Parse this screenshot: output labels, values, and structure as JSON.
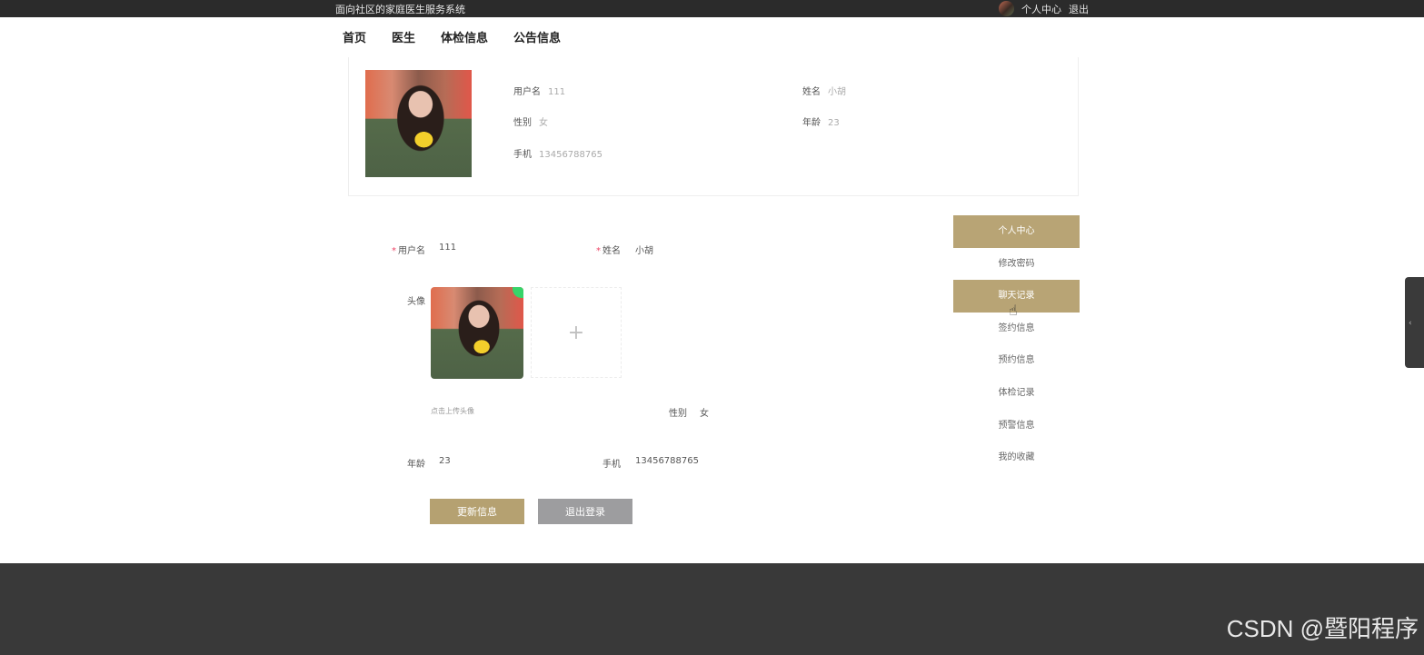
{
  "header": {
    "site_title": "面向社区的家庭医生服务系统",
    "personal_center": "个人中心",
    "logout": "退出"
  },
  "nav": {
    "items": [
      {
        "label": "首页"
      },
      {
        "label": "医生"
      },
      {
        "label": "体检信息"
      },
      {
        "label": "公告信息"
      }
    ]
  },
  "profile": {
    "username_label": "用户名",
    "username": "111",
    "name_label": "姓名",
    "name": "小胡",
    "gender_label": "性别",
    "gender": "女",
    "age_label": "年龄",
    "age": "23",
    "phone_label": "手机",
    "phone": "13456788765"
  },
  "form": {
    "username_label": "用户名",
    "username_value": "111",
    "name_label": "姓名",
    "name_value": "小胡",
    "avatar_label": "头像",
    "upload_plus": "+",
    "upload_hint": "点击上传头像",
    "gender_label": "性别",
    "gender_value": "女",
    "age_label": "年龄",
    "age_value": "23",
    "phone_label": "手机",
    "phone_value": "13456788765",
    "update_button": "更新信息",
    "logout_button": "退出登录"
  },
  "side_menu": {
    "items": [
      {
        "label": "个人中心"
      },
      {
        "label": "修改密码"
      },
      {
        "label": "聊天记录"
      },
      {
        "label": "签约信息"
      },
      {
        "label": "预约信息"
      },
      {
        "label": "体检记录"
      },
      {
        "label": "预警信息"
      },
      {
        "label": "我的收藏"
      }
    ]
  },
  "footer": {
    "watermark": "CSDN @暨阳程序"
  },
  "colors": {
    "accent": "#b8a475",
    "topbar": "#2b2b2b",
    "footer": "#393939",
    "secondary_button": "#9d9d9f"
  }
}
